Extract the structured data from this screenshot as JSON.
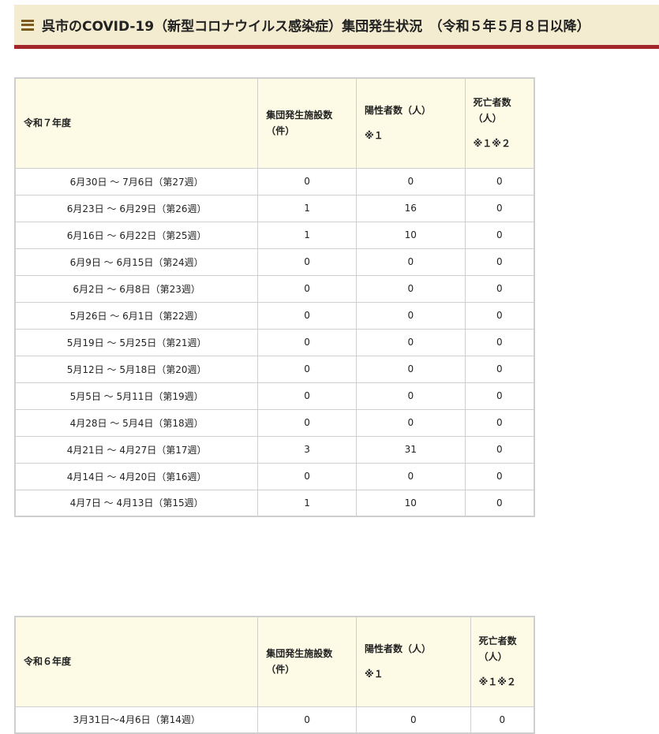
{
  "heading": {
    "title": "呉市のCOVID-19（新型コロナウイルス感染症）集団発生状況　（令和５年５月８日以降）",
    "icon": "menu-lines-icon",
    "accent_color": "#a3262a",
    "background_color": "#f3ecd0"
  },
  "tables": [
    {
      "year_label": "令和７年度",
      "columns": {
        "facilities_line1": "集団発生施設数",
        "facilities_line2": "（件）",
        "positives_line1": "陽性者数（人）",
        "positives_note": "※１",
        "deaths_line1": "死亡者数",
        "deaths_line2": "（人）",
        "deaths_note": "※１※２"
      },
      "rows": [
        {
          "period": "6月30日 ～ 7月6日（第27週）",
          "facilities": "0",
          "positives": "0",
          "deaths": "0"
        },
        {
          "period": "6月23日 ～ 6月29日（第26週）",
          "facilities": "1",
          "positives": "16",
          "deaths": "0"
        },
        {
          "period": "6月16日 ～ 6月22日（第25週）",
          "facilities": "1",
          "positives": "10",
          "deaths": "0"
        },
        {
          "period": "6月9日 ～ 6月15日（第24週）",
          "facilities": "0",
          "positives": "0",
          "deaths": "0"
        },
        {
          "period": "6月2日 ～ 6月8日（第23週）",
          "facilities": "0",
          "positives": "0",
          "deaths": "0"
        },
        {
          "period": "5月26日 ～ 6月1日（第22週）",
          "facilities": "0",
          "positives": "0",
          "deaths": "0"
        },
        {
          "period": "5月19日 ～ 5月25日（第21週）",
          "facilities": "0",
          "positives": "0",
          "deaths": "0"
        },
        {
          "period": "5月12日 ～ 5月18日（第20週）",
          "facilities": "0",
          "positives": "0",
          "deaths": "0"
        },
        {
          "period": "5月5日 ～ 5月11日（第19週）",
          "facilities": "0",
          "positives": "0",
          "deaths": "0"
        },
        {
          "period": "4月28日 ～ 5月4日（第18週）",
          "facilities": "0",
          "positives": "0",
          "deaths": "0"
        },
        {
          "period": "4月21日 ～ 4月27日（第17週）",
          "facilities": "3",
          "positives": "31",
          "deaths": "0"
        },
        {
          "period": "4月14日 ～ 4月20日（第16週）",
          "facilities": "0",
          "positives": "0",
          "deaths": "0"
        },
        {
          "period": "4月7日 ～ 4月13日（第15週）",
          "facilities": "1",
          "positives": "10",
          "deaths": "0"
        }
      ]
    },
    {
      "year_label": "令和６年度",
      "columns": {
        "facilities_line1": "集団発生施設数",
        "facilities_line2": "（件）",
        "positives_line1": "陽性者数（人）",
        "positives_note": "※１",
        "deaths_line1": "死亡者数",
        "deaths_line2": "（人）",
        "deaths_note": "※１※２"
      },
      "rows": [
        {
          "period": "3月31日～4月6日（第14週）",
          "facilities": "0",
          "positives": "0",
          "deaths": "0"
        }
      ]
    }
  ]
}
